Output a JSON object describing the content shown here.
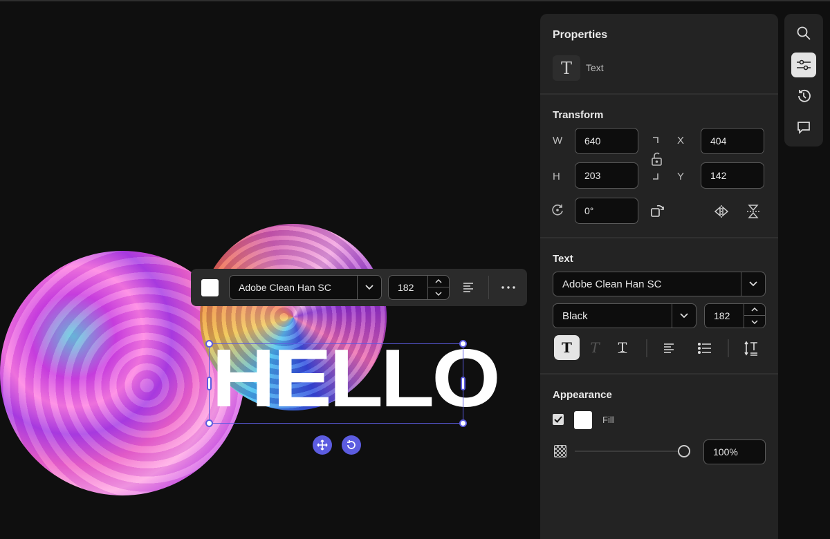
{
  "canvas": {
    "text": "HELLO"
  },
  "floating_toolbar": {
    "font": "Adobe Clean Han SC",
    "size": "182",
    "fill_color": "#ffffff"
  },
  "properties": {
    "title": "Properties",
    "object_type": "Text",
    "transform": {
      "title": "Transform",
      "w_label": "W",
      "w": "640",
      "h_label": "H",
      "h": "203",
      "x_label": "X",
      "x": "404",
      "y_label": "Y",
      "y": "142",
      "rotation": "0°"
    },
    "text": {
      "title": "Text",
      "font": "Adobe Clean Han SC",
      "weight": "Black",
      "size": "182"
    },
    "appearance": {
      "title": "Appearance",
      "fill_label": "Fill",
      "fill_checked": true,
      "fill_color": "#ffffff",
      "opacity": "100%",
      "opacity_value": 100
    }
  },
  "colors": {
    "accent": "#5c5ce0",
    "panel": "#232323"
  }
}
